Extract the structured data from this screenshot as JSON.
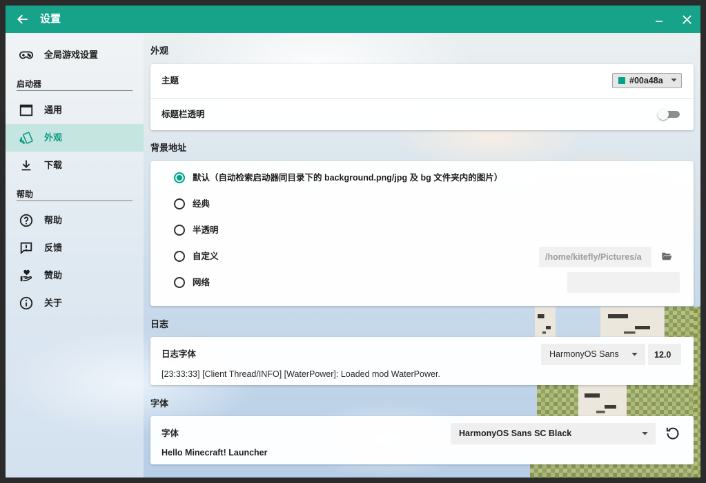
{
  "window": {
    "title": "设置",
    "back_icon": "arrow-left-icon",
    "minimize_icon": "minimize-icon",
    "close_icon": "close-icon"
  },
  "colors": {
    "accent": "#00a48a",
    "titlebar": "#16a38a"
  },
  "sidebar": {
    "top_item": {
      "label": "全局游戏设置",
      "icon": "gamepad-icon"
    },
    "sections": [
      {
        "title": "启动器",
        "items": [
          {
            "label": "通用",
            "icon": "window-icon",
            "selected": false
          },
          {
            "label": "外观",
            "icon": "style-icon",
            "selected": true
          },
          {
            "label": "下载",
            "icon": "download-icon",
            "selected": false
          }
        ]
      },
      {
        "title": "帮助",
        "items": [
          {
            "label": "帮助",
            "icon": "help-circle-icon",
            "selected": false
          },
          {
            "label": "反馈",
            "icon": "feedback-icon",
            "selected": false
          },
          {
            "label": "赞助",
            "icon": "hand-heart-icon",
            "selected": false
          },
          {
            "label": "关于",
            "icon": "info-icon",
            "selected": false
          }
        ]
      }
    ]
  },
  "appearance": {
    "heading": "外观",
    "theme": {
      "label": "主题",
      "value": "#00a48a"
    },
    "transparent_titlebar": {
      "label": "标题栏透明",
      "on": false
    }
  },
  "background": {
    "heading": "背景地址",
    "options": [
      {
        "label": "默认（自动检索启动器同目录下的 background.png/jpg 及 bg 文件夹内的图片）",
        "selected": true
      },
      {
        "label": "经典",
        "selected": false
      },
      {
        "label": "半透明",
        "selected": false
      },
      {
        "label": "自定义",
        "selected": false
      },
      {
        "label": "网络",
        "selected": false
      }
    ],
    "custom_path": "/home/kitefly/Pictures/a",
    "custom_browse_icon": "folder-open-icon",
    "network_url": ""
  },
  "log": {
    "heading": "日志",
    "font": {
      "label": "日志字体",
      "selected": "HarmonyOS Sans",
      "size": "12.0"
    },
    "preview": "[23:33:33] [Client Thread/INFO] [WaterPower]: Loaded mod WaterPower."
  },
  "font": {
    "heading": "字体",
    "font": {
      "label": "字体",
      "selected": "HarmonyOS Sans SC Black",
      "reset_icon": "restore-icon"
    },
    "preview": "Hello Minecraft! Launcher"
  }
}
